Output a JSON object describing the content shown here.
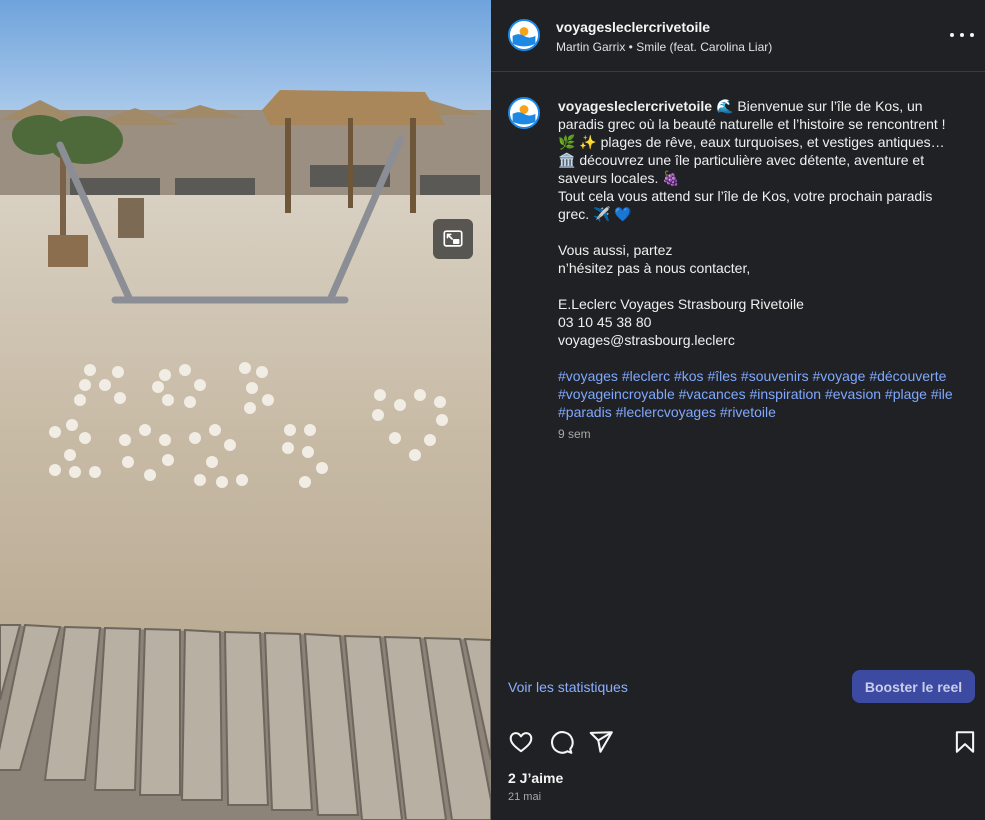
{
  "post": {
    "username": "voyagesleclercrivetoile",
    "audio": "Martin Garrix • Smile (feat. Carolina Liar)"
  },
  "caption": {
    "username": "voyagesleclercrivetoile",
    "line1": "🌊 Bienvenue sur l’île de Kos, un paradis grec où la beauté naturelle et l’histoire se rencontrent ! 🌿 ✨ plages de rêve, eaux turquoises, et vestiges antiques… 🏛️ découvrez une île particulière avec détente, aventure et saveurs locales. 🍇",
    "line2": "Tout cela vous attend sur l’île de Kos, votre prochain paradis grec. ✈️ 💙",
    "line3": "Vous aussi, partez",
    "line4": "n’hésitez pas à nous contacter,",
    "contact_name": "E.Leclerc Voyages Strasbourg Rivetoile",
    "contact_phone": "03 10 45 38 80",
    "contact_email": "voyages@strasbourg.leclerc",
    "hashtags": [
      "#voyages",
      "#leclerc",
      "#kos",
      "#îles",
      "#souvenirs",
      "#voyage",
      "#découverte",
      "#voyageincroyable",
      "#vacances",
      "#inspiration",
      "#evasion",
      "#plage",
      "#ile",
      "#paradis",
      "#leclercvoyages",
      "#rivetoile"
    ],
    "time_ago": "9 sem"
  },
  "footer": {
    "stats_link": "Voir les statistiques",
    "boost_button": "Booster le reel",
    "likes": "2 J’aime",
    "date": "21 mai"
  },
  "icons": {
    "header_more": "more-horizontal-icon",
    "pip": "picture-in-picture-icon",
    "like": "heart-icon",
    "comment": "comment-icon",
    "share": "share-icon",
    "save": "bookmark-icon"
  },
  "colors": {
    "panel_bg": "#202124",
    "link": "#7fa8ff",
    "boost_bg": "#3c4ba1",
    "avatar_ring": "#1e88e5"
  }
}
